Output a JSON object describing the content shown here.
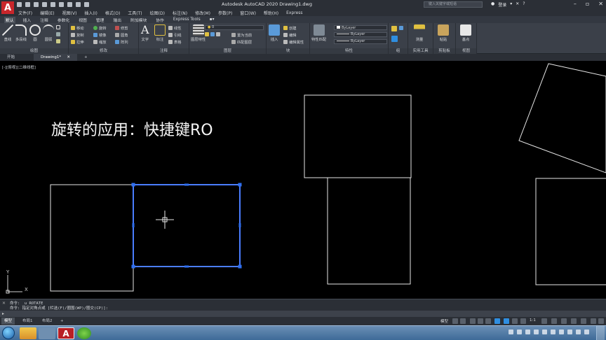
{
  "app": {
    "logo_letter": "A",
    "title": "Autodesk AutoCAD 2020    Drawing1.dwg",
    "search_placeholder": "键入关键字或短语",
    "user_label": "登录"
  },
  "menu": [
    "文件(F)",
    "编辑(E)",
    "视图(V)",
    "插入(I)",
    "格式(O)",
    "工具(T)",
    "绘图(D)",
    "标注(N)",
    "修改(M)",
    "参数(P)",
    "窗口(W)",
    "帮助(H)",
    "Express"
  ],
  "ribbon_tabs": [
    "默认",
    "插入",
    "注释",
    "参数化",
    "视图",
    "管理",
    "输出",
    "附加模块",
    "协作",
    "Express Tools"
  ],
  "panels": {
    "draw": {
      "title": "绘图",
      "line": "直线",
      "polyline": "多段线",
      "circle": "圆",
      "arc": "圆弧"
    },
    "modify": {
      "title": "修改",
      "move": "移动",
      "rotate": "旋转",
      "trim": "修剪",
      "copy": "复制",
      "mirror": "镜像",
      "fillet": "圆角",
      "stretch": "拉伸",
      "scale": "缩放",
      "array": "阵列"
    },
    "annotation": {
      "title": "注释",
      "text": "文字",
      "dimension": "标注",
      "linear": "线性",
      "leader": "引线",
      "table": "表格"
    },
    "layers": {
      "title": "图层",
      "layer_props": "图层特性",
      "current_layer": "0",
      "make_current": "置为当前",
      "match_layer": "匹配图层"
    },
    "block": {
      "title": "块",
      "insert": "插入",
      "create": "创建",
      "edit": "编辑",
      "edit_attrs": "编辑属性"
    },
    "properties": {
      "title": "特性",
      "match": "特性匹配",
      "color": "ByLayer",
      "linetype": "ByLayer",
      "lineweight": "ByLayer"
    },
    "groups": {
      "title": "组"
    },
    "utilities": {
      "title": "实用工具",
      "measure": "测量"
    },
    "clipboard": {
      "title": "剪贴板",
      "paste": "粘贴"
    },
    "view": {
      "title": "视图",
      "base": "基点"
    }
  },
  "file_tabs": [
    "开始",
    "Drawing1*"
  ],
  "viewport_label": "[-][俯视][二维线框]",
  "heading": "旋转的应用：快捷键RO",
  "command": {
    "line1": "命令: _u ROTATE",
    "line2": "命令: 指定对角点或 [栏选(F)/圈围(WP)/圈交(CP)]:",
    "prompt": ""
  },
  "layout_tabs": [
    "模型",
    "布局1",
    "布局2"
  ],
  "status": {
    "model_label": "模型",
    "scale": "1:1"
  },
  "colors": {
    "accent": "#2f8ee0",
    "selection": "#4a7dff",
    "brand": "#c8262b"
  }
}
